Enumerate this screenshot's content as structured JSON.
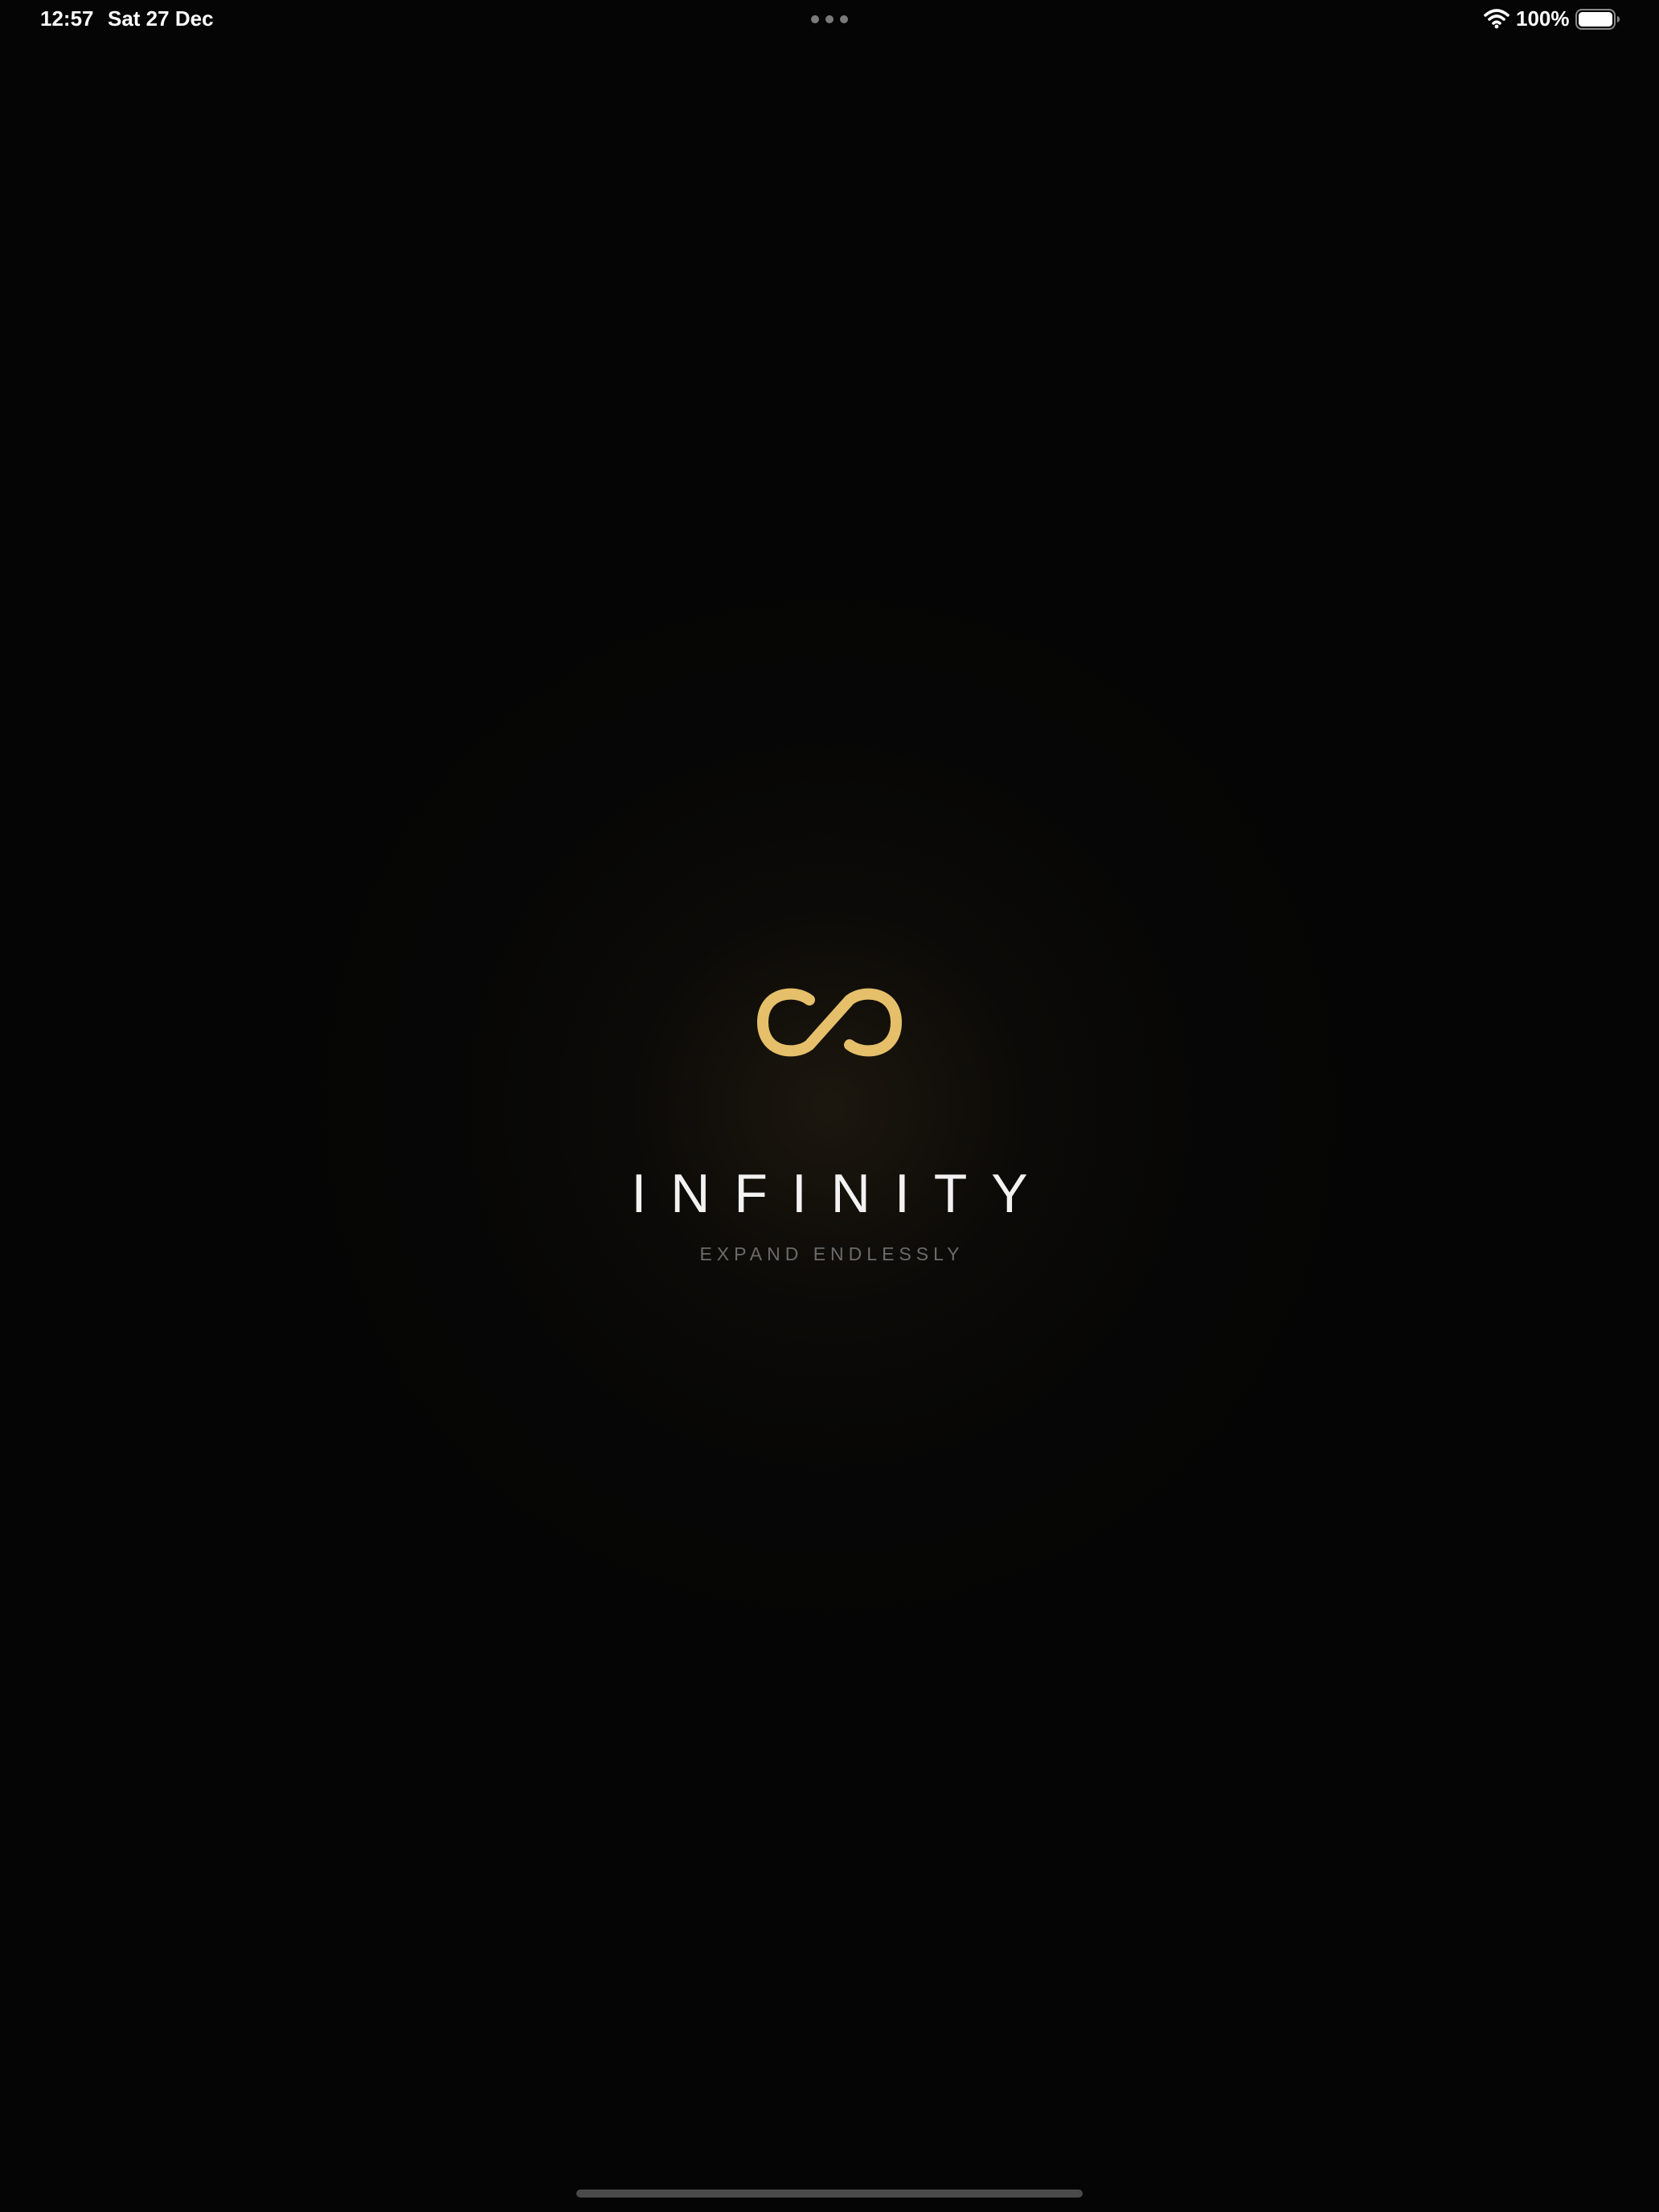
{
  "status_bar": {
    "time": "12:57",
    "date": "Sat 27 Dec",
    "battery_percent": "100%",
    "icons": [
      "multitasking-dots-icon",
      "wifi-icon",
      "battery-icon"
    ]
  },
  "splash": {
    "logo_icon": "infinity-icon",
    "title": "INFINITY",
    "tagline": "EXPAND ENDLESSLY"
  },
  "colors": {
    "background": "#050505",
    "accent_gold": "#E5BF6A",
    "title_text": "#F2F2F2",
    "tagline_text": "#6B6B6B"
  }
}
